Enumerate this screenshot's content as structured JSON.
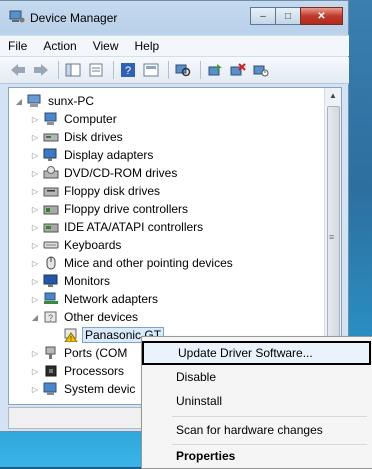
{
  "window": {
    "title": "Device Manager",
    "caption_buttons": {
      "minimize": "‒",
      "maximize": "□",
      "close": "✕"
    }
  },
  "menu": [
    "File",
    "Action",
    "View",
    "Help"
  ],
  "toolbar_icons": [
    "back-icon",
    "forward-icon",
    "console-tree-icon",
    "properties-icon",
    "help-icon",
    "show-hide-icon",
    "scan-hardware-icon",
    "update-driver-icon",
    "uninstall-icon",
    "disable-icon"
  ],
  "tree": {
    "root": "sunx-PC",
    "categories": [
      {
        "label": "Computer",
        "expanded": false
      },
      {
        "label": "Disk drives",
        "expanded": false
      },
      {
        "label": "Display adapters",
        "expanded": false
      },
      {
        "label": "DVD/CD-ROM drives",
        "expanded": false
      },
      {
        "label": "Floppy disk drives",
        "expanded": false
      },
      {
        "label": "Floppy drive controllers",
        "expanded": false
      },
      {
        "label": "IDE ATA/ATAPI controllers",
        "expanded": false
      },
      {
        "label": "Keyboards",
        "expanded": false
      },
      {
        "label": "Mice and other pointing devices",
        "expanded": false
      },
      {
        "label": "Monitors",
        "expanded": false
      },
      {
        "label": "Network adapters",
        "expanded": false
      },
      {
        "label": "Other devices",
        "expanded": true
      },
      {
        "label": "Ports (COM",
        "expanded": false
      },
      {
        "label": "Processors",
        "expanded": false
      },
      {
        "label": "System devic",
        "expanded": false
      }
    ],
    "child_device": "Panasonic GT"
  },
  "context_menu": {
    "items": [
      "Update Driver Software...",
      "Disable",
      "Uninstall",
      "Scan for hardware changes",
      "Properties"
    ],
    "highlighted": "Update Driver Software..."
  }
}
